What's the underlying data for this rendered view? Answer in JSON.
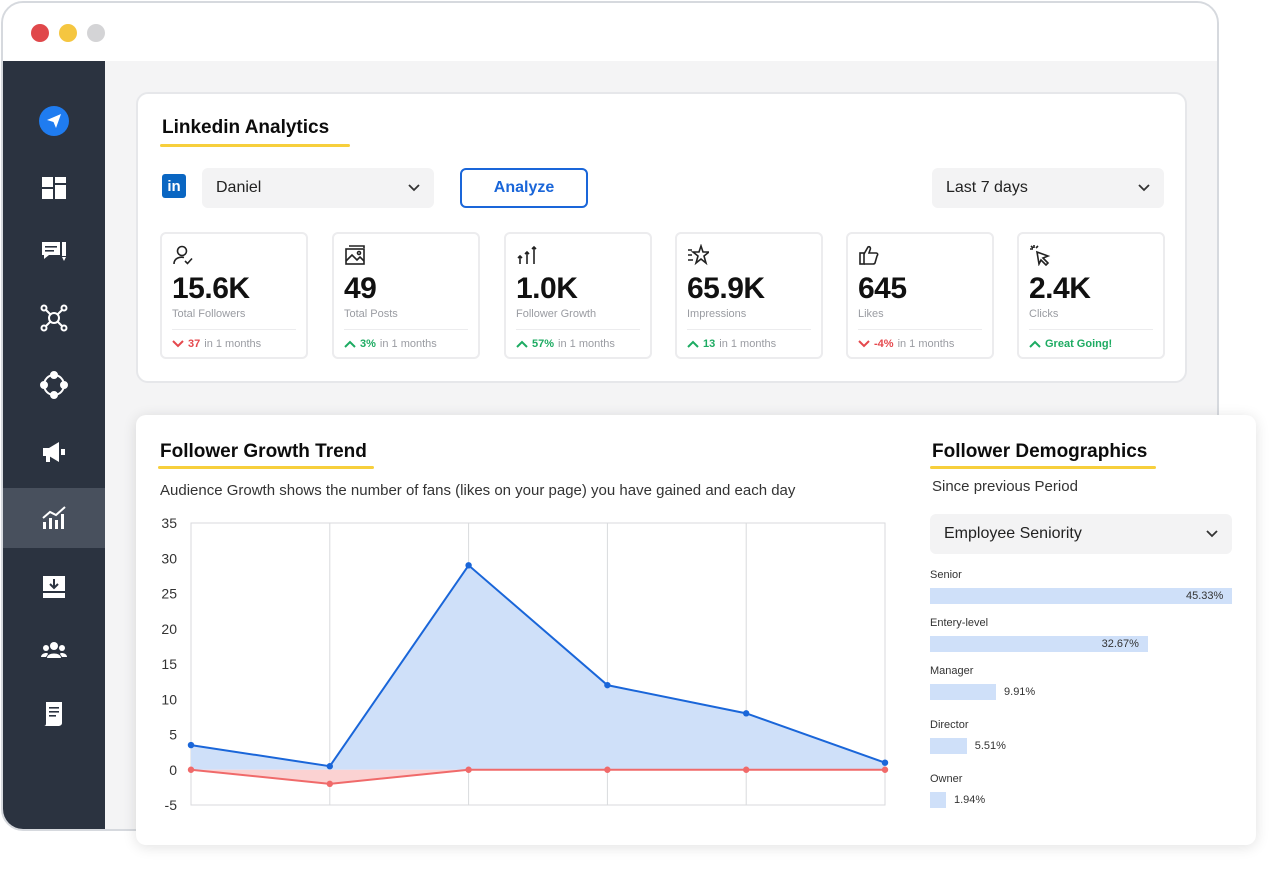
{
  "analytics": {
    "title": "Linkedin Analytics",
    "linkedin_logo": "in",
    "account": "Daniel",
    "analyze_label": "Analyze",
    "period": "Last 7 days"
  },
  "stats": [
    {
      "icon": "user-check-icon",
      "value": "15.6K",
      "label": "Total Followers",
      "change": "37",
      "direction": "down",
      "suffix": "in 1 months"
    },
    {
      "icon": "image-icon",
      "value": "49",
      "label": "Total Posts",
      "change": "3%",
      "direction": "up",
      "suffix": "in 1 months"
    },
    {
      "icon": "growth-arrows-icon",
      "value": "1.0K",
      "label": "Follower Growth",
      "change": "57%",
      "direction": "up",
      "suffix": "in 1 months"
    },
    {
      "icon": "star-lines-icon",
      "value": "65.9K",
      "label": "Impressions",
      "change": "13",
      "direction": "up",
      "suffix": "in 1 months"
    },
    {
      "icon": "thumbs-up-icon",
      "value": "645",
      "label": "Likes",
      "change": "-4%",
      "direction": "down",
      "suffix": "in 1 months"
    },
    {
      "icon": "cursor-click-icon",
      "value": "2.4K",
      "label": "Clicks",
      "change": "Great Going!",
      "direction": "up",
      "suffix": ""
    }
  ],
  "growth": {
    "title": "Follower Growth Trend",
    "description": "Audience Growth shows the number of fans (likes on your page) you have gained and each day"
  },
  "chart_data": {
    "type": "area",
    "x": [
      1,
      2,
      3,
      4,
      5,
      6
    ],
    "ylim": [
      -5,
      35
    ],
    "yticks": [
      35,
      30,
      25,
      20,
      15,
      10,
      5,
      0,
      -5
    ],
    "grid": true,
    "series": [
      {
        "values": [
          3.5,
          0.5,
          29,
          12,
          8,
          1
        ],
        "color": "#1a66d9",
        "fill": "#cfe0f9"
      },
      {
        "values": [
          0,
          -2,
          0,
          0,
          0,
          0
        ],
        "color": "#f06a6a",
        "fill": "#fbd2d2"
      }
    ]
  },
  "demographics": {
    "title": "Follower Demographics",
    "subtitle": "Since previous Period",
    "dropdown": "Employee Seniority",
    "items": [
      {
        "label": "Senior",
        "pct": 45.33,
        "pct_label": "45.33%"
      },
      {
        "label": "Entery-level",
        "pct": 32.67,
        "pct_label": "32.67%"
      },
      {
        "label": "Manager",
        "pct": 9.91,
        "pct_label": "9.91%"
      },
      {
        "label": "Director",
        "pct": 5.51,
        "pct_label": "5.51%"
      },
      {
        "label": "Owner",
        "pct": 1.94,
        "pct_label": "1.94%"
      }
    ]
  },
  "sidebar": {
    "items": [
      {
        "icon": "send-icon"
      },
      {
        "icon": "dashboard-icon"
      },
      {
        "icon": "chat-icon"
      },
      {
        "icon": "network-icon"
      },
      {
        "icon": "cycle-icon"
      },
      {
        "icon": "megaphone-icon"
      },
      {
        "icon": "analytics-icon",
        "active": true
      },
      {
        "icon": "inbox-download-icon"
      },
      {
        "icon": "team-icon"
      },
      {
        "icon": "document-icon"
      }
    ]
  }
}
